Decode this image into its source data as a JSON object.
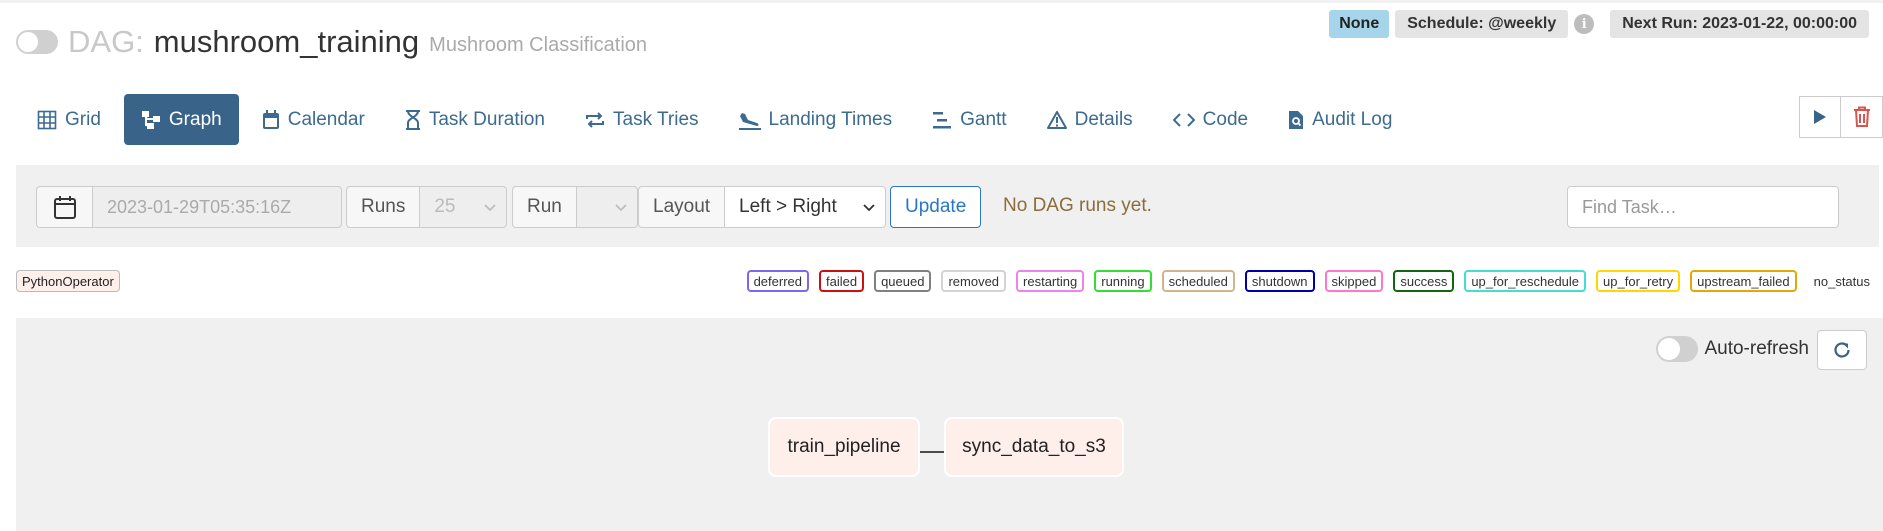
{
  "header": {
    "dag_prefix": "DAG:",
    "dag_id": "mushroom_training",
    "description": "Mushroom Classification",
    "status_badge": "None",
    "schedule": "Schedule: @weekly",
    "next_run": "Next Run: 2023-01-22, 00:00:00"
  },
  "tabs": [
    {
      "label": "Grid",
      "icon": "grid-icon"
    },
    {
      "label": "Graph",
      "icon": "graph-icon",
      "active": true
    },
    {
      "label": "Calendar",
      "icon": "calendar-icon"
    },
    {
      "label": "Task Duration",
      "icon": "hourglass-icon"
    },
    {
      "label": "Task Tries",
      "icon": "retry-icon"
    },
    {
      "label": "Landing Times",
      "icon": "plane-landing-icon"
    },
    {
      "label": "Gantt",
      "icon": "gantt-icon"
    },
    {
      "label": "Details",
      "icon": "warning-icon"
    },
    {
      "label": "Code",
      "icon": "code-icon"
    },
    {
      "label": "Audit Log",
      "icon": "file-search-icon"
    }
  ],
  "filters": {
    "date_value": "2023-01-29T05:35:16Z",
    "runs_label": "Runs",
    "runs_value": "25",
    "run_label": "Run",
    "run_value": "",
    "layout_label": "Layout",
    "layout_value": "Left > Right",
    "update_label": "Update",
    "no_runs": "No DAG runs yet.",
    "find_placeholder": "Find Task…"
  },
  "operator_tag": "PythonOperator",
  "legend": [
    {
      "label": "deferred",
      "color": "#7b68ee"
    },
    {
      "label": "failed",
      "color": "#cc1111"
    },
    {
      "label": "queued",
      "color": "#808080"
    },
    {
      "label": "removed",
      "color": "#d3d3d3"
    },
    {
      "label": "restarting",
      "color": "#ee82ee"
    },
    {
      "label": "running",
      "color": "#33dd33"
    },
    {
      "label": "scheduled",
      "color": "#d2b48c"
    },
    {
      "label": "shutdown",
      "color": "#0000aa"
    },
    {
      "label": "skipped",
      "color": "#ff77cc"
    },
    {
      "label": "success",
      "color": "#116611"
    },
    {
      "label": "up_for_reschedule",
      "color": "#40e0d0"
    },
    {
      "label": "up_for_retry",
      "color": "#ffd700"
    },
    {
      "label": "upstream_failed",
      "color": "#e6a800"
    },
    {
      "label": "no_status",
      "color": "transparent"
    }
  ],
  "graph": {
    "auto_refresh_label": "Auto-refresh",
    "nodes": [
      {
        "label": "train_pipeline"
      },
      {
        "label": "sync_data_to_s3"
      }
    ]
  }
}
